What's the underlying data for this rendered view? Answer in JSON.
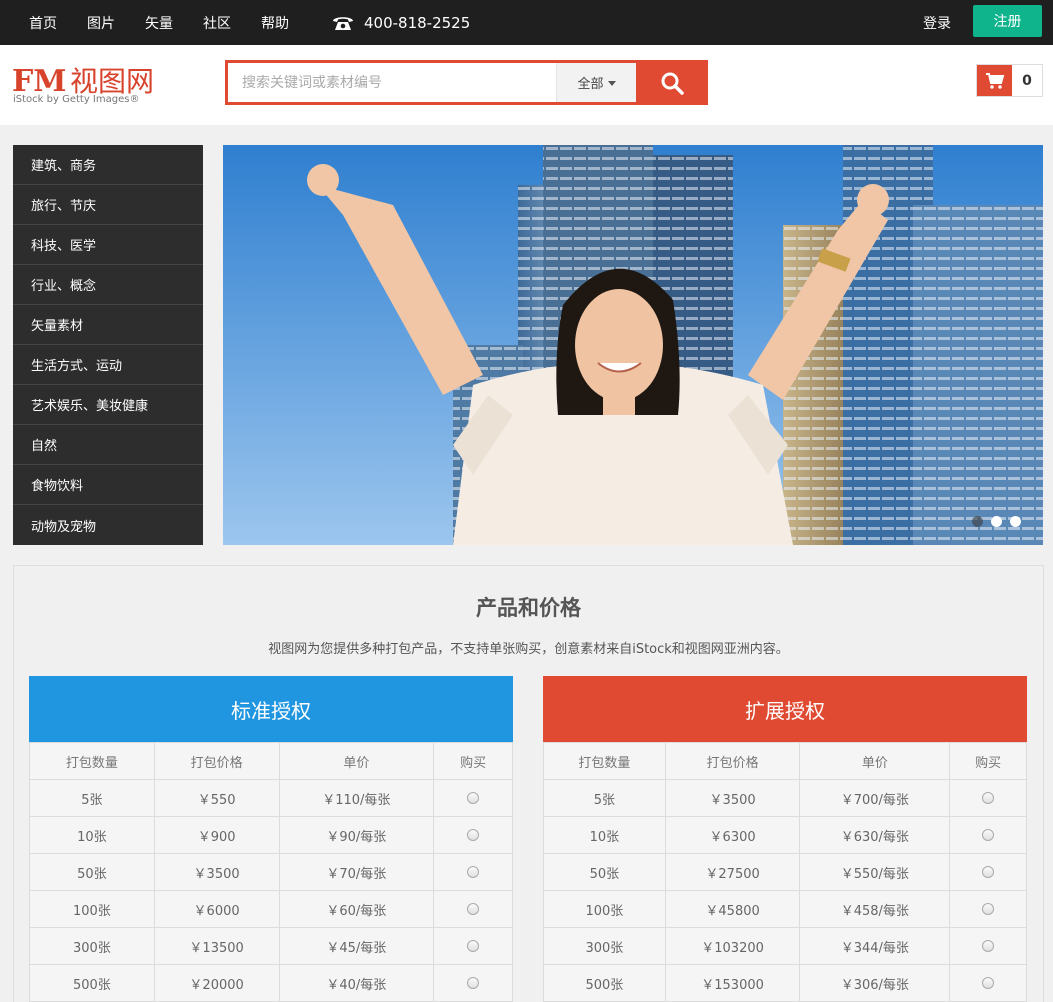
{
  "topnav": {
    "items": [
      "首页",
      "图片",
      "矢量",
      "社区",
      "帮助"
    ],
    "phone": "400-818-2525",
    "login": "登录",
    "register": "注册"
  },
  "header": {
    "logo_mark": "FM",
    "logo_text": "视图网",
    "logo_sub": "iStock by Getty Images®",
    "search_placeholder": "搜索关键词或素材编号",
    "search_scope": "全部",
    "cart_count": "0"
  },
  "categories": [
    "建筑、商务",
    "旅行、节庆",
    "科技、医学",
    "行业、概念",
    "矢量素材",
    "生活方式、运动",
    "艺术娱乐、美妆健康",
    "自然",
    "食物饮料",
    "动物及宠物"
  ],
  "banner": {
    "slide_count": 3,
    "active_slide": 3
  },
  "pricing": {
    "title": "产品和价格",
    "description": "视图网为您提供多种打包产品，不支持单张购买，创意素材来自iStock和视图网亚洲内容。",
    "columns": [
      "打包数量",
      "打包价格",
      "单价",
      "购买"
    ],
    "standard": {
      "title": "标准授权",
      "color": "#2196e0",
      "rows": [
        [
          "5张",
          "￥550",
          "￥110/每张"
        ],
        [
          "10张",
          "￥900",
          "￥90/每张"
        ],
        [
          "50张",
          "￥3500",
          "￥70/每张"
        ],
        [
          "100张",
          "￥6000",
          "￥60/每张"
        ],
        [
          "300张",
          "￥13500",
          "￥45/每张"
        ],
        [
          "500张",
          "￥20000",
          "￥40/每张"
        ]
      ]
    },
    "extended": {
      "title": "扩展授权",
      "color": "#e04a32",
      "rows": [
        [
          "5张",
          "￥3500",
          "￥700/每张"
        ],
        [
          "10张",
          "￥6300",
          "￥630/每张"
        ],
        [
          "50张",
          "￥27500",
          "￥550/每张"
        ],
        [
          "100张",
          "￥45800",
          "￥458/每张"
        ],
        [
          "300张",
          "￥103200",
          "￥344/每张"
        ],
        [
          "500张",
          "￥153000",
          "￥306/每张"
        ]
      ]
    }
  }
}
